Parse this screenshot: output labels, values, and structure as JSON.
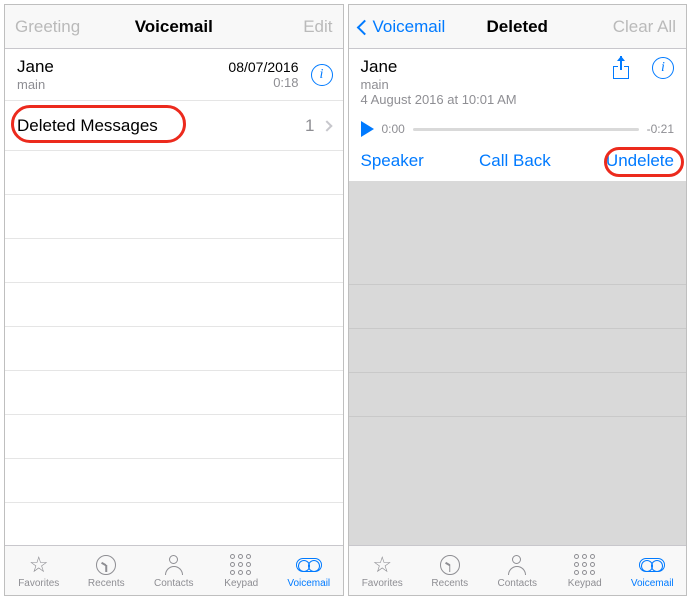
{
  "left": {
    "nav": {
      "left": "Greeting",
      "title": "Voicemail",
      "right": "Edit"
    },
    "vm_row": {
      "name": "Jane",
      "sub": "main",
      "date": "08/07/2016",
      "duration": "0:18"
    },
    "deleted_row": {
      "label": "Deleted Messages",
      "count": "1"
    }
  },
  "right": {
    "nav": {
      "back": "Voicemail",
      "title": "Deleted",
      "right": "Clear All"
    },
    "caller": {
      "name": "Jane",
      "sub": "main",
      "timestamp": "4 August 2016 at 10:01 AM"
    },
    "playback": {
      "elapsed": "0:00",
      "remaining": "-0:21"
    },
    "actions": {
      "speaker": "Speaker",
      "callback": "Call Back",
      "undelete": "Undelete"
    }
  },
  "tabs": {
    "favorites": "Favorites",
    "recents": "Recents",
    "contacts": "Contacts",
    "keypad": "Keypad",
    "voicemail": "Voicemail"
  },
  "colors": {
    "tint": "#007aff",
    "highlight": "#ec2a1d"
  }
}
